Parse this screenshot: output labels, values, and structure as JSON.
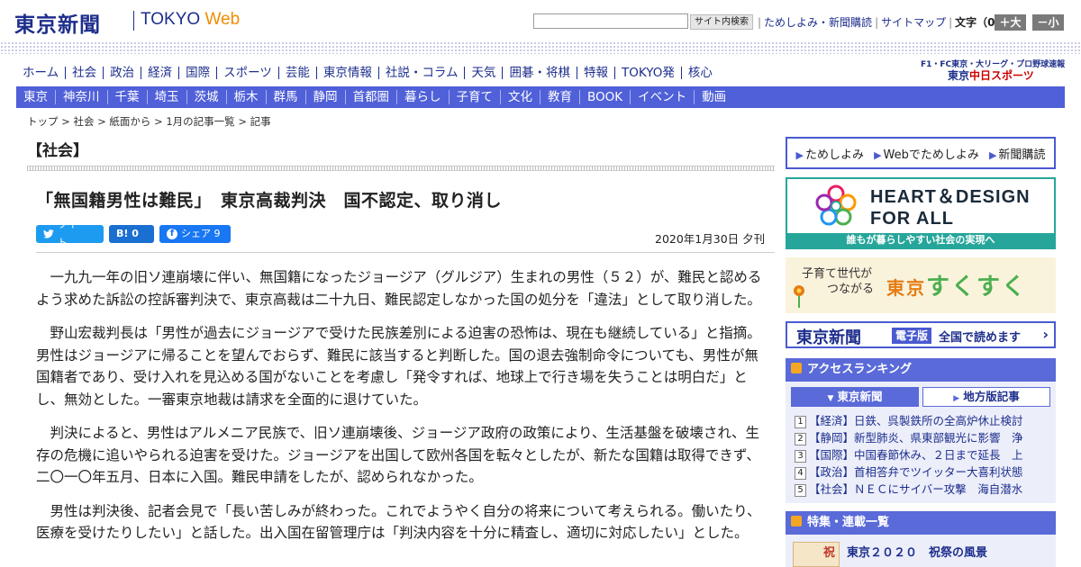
{
  "header": {
    "logo": "東京新聞",
    "logo_sub": "TOKYO ",
    "logo_web": "Web",
    "search_button": "サイト内検索",
    "links": [
      "ためしよみ・新聞購読",
      "サイトマップ"
    ],
    "font_size_label": "文字（0）",
    "font_plus": "＋大",
    "font_minus": "－小"
  },
  "nav_main": [
    "ホーム",
    "社会",
    "政治",
    "経済",
    "国際",
    "スポーツ",
    "芸能",
    "東京情報",
    "社説・コラム",
    "天気",
    "囲碁・将棋",
    "特報",
    "TOKYO発",
    "核心"
  ],
  "promo": {
    "line1": "F1・FC東京・大リーグ・プロ野球速報",
    "line2_a": "東京",
    "line2_b": "中日スポーツ"
  },
  "nav_sub": [
    "東京",
    "神奈川",
    "千葉",
    "埼玉",
    "茨城",
    "栃木",
    "群馬",
    "静岡",
    "首都圏",
    "暮らし",
    "子育て",
    "文化",
    "教育",
    "BOOK",
    "イベント",
    "動画"
  ],
  "breadcrumb": [
    "トップ",
    "社会",
    "紙面から",
    "1月の記事一覧",
    "記事"
  ],
  "article": {
    "section": "【社会】",
    "headline": "「無国籍男性は難民」　東京高裁判決　国不認定、取り消し",
    "share": {
      "tweet": "ツイート",
      "hatena": "B! 0",
      "facebook": "シェア 9"
    },
    "date": "2020年1月30日 夕刊",
    "paragraphs": [
      "一九九一年の旧ソ連崩壊に伴い、無国籍になったジョージア（グルジア）生まれの男性（５２）が、難民と認めるよう求めた訴訟の控訴審判決で、東京高裁は二十九日、難民認定しなかった国の処分を「違法」として取り消した。",
      "野山宏裁判長は「男性が過去にジョージアで受けた民族差別による迫害の恐怖は、現在も継続している」と指摘。男性はジョージアに帰ることを望んでおらず、難民に該当すると判断した。国の退去強制命令についても、男性が無国籍者であり、受け入れを見込める国がないことを考慮し「発令すれば、地球上で行き場を失うことは明白だ」とし、無効とした。一審東京地裁は請求を全面的に退けていた。",
      "判決によると、男性はアルメニア民族で、旧ソ連崩壊後、ジョージア政府の政策により、生活基盤を破壊され、生存の危機に追いやられる迫害を受けた。ジョージアを出国して欧州各国を転々としたが、新たな国籍は取得できず、二〇一〇年五月、日本に入国。難民申請をしたが、認められなかった。",
      "男性は判決後、記者会見で「長い苦しみが終わった。これでようやく自分の将来について考えられる。働いたり、医療を受けたりしたい」と話した。出入国在留管理庁は「判決内容を十分に精査し、適切に対応したい」とした。"
    ]
  },
  "sidebar": {
    "tameshi": [
      "ためしよみ",
      "Webでためしよみ",
      "新聞購読"
    ],
    "heart_design": {
      "title_line1": "HEART＆DESIGN",
      "title_line2": "FOR ALL",
      "bar": "誰もが暮らしやすい社会の実現へ"
    },
    "sukusuku": {
      "sub_line1": "子育て世代が",
      "sub_line2": "つながる",
      "main_a": "東京",
      "main_b": "すくすく"
    },
    "edition": {
      "logo": "東京新聞",
      "tag": "電子版",
      "text": "全国で読めます"
    },
    "ranking": {
      "title": "アクセスランキング",
      "tabs": [
        "東京新聞",
        "地方版記事"
      ],
      "items": [
        "【経済】日鉄、呉製鉄所の全高炉休止検討",
        "【静岡】新型肺炎、県東部観光に影響　浄",
        "【国際】中国春節休み、２日まで延長　上",
        "【政治】首相答弁でツイッター大喜利状態",
        "【社会】ＮＥＣにサイバー攻撃　海自潜水"
      ]
    },
    "features": {
      "title": "特集・連載一覧",
      "thumb": "祝",
      "item": "東京２０２０　祝祭の風景"
    }
  }
}
